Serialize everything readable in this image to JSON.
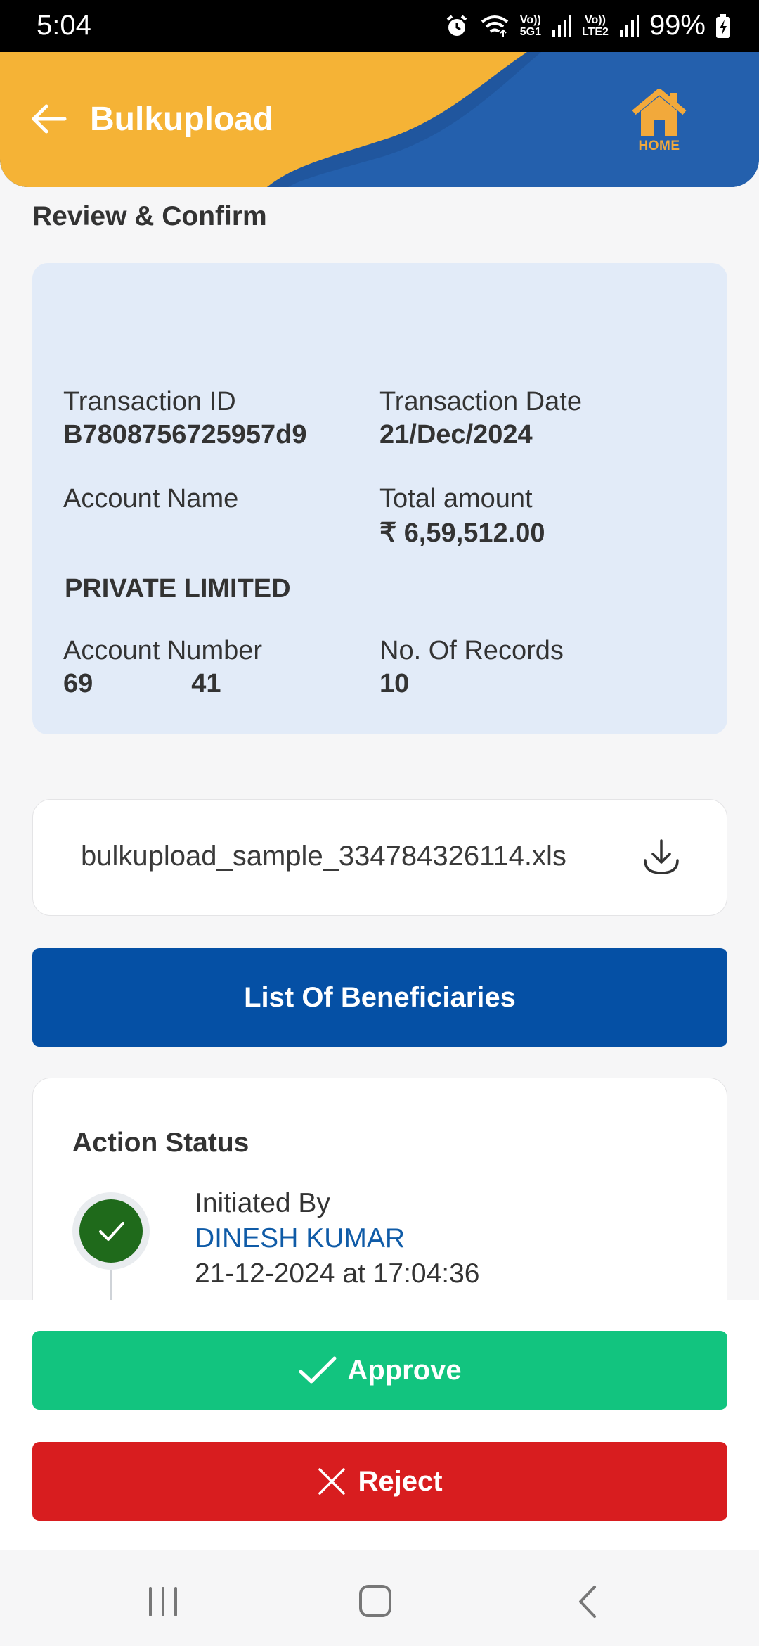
{
  "status_bar": {
    "time": "5:04",
    "sim1_top": "Vo))",
    "sim1_bottom": "5G1",
    "sim2_top": "Vo))",
    "sim2_bottom": "LTE2",
    "battery": "99%"
  },
  "header": {
    "title": "Bulkupload",
    "home_label": "HOME",
    "colors": {
      "blue": "#2460ad",
      "orange": "#f5b336"
    }
  },
  "review": {
    "title": "Review & Confirm",
    "transaction_id_label": "Transaction ID",
    "transaction_id": "B7808756725957d9",
    "transaction_date_label": "Transaction Date",
    "transaction_date": "21/Dec/2024",
    "account_name_label": "Account Name",
    "total_amount_label": "Total amount",
    "total_amount": "₹ 6,59,512.00",
    "company_name": "PRIVATE LIMITED",
    "account_number_label": "Account Number",
    "account_number_start": "69",
    "account_number_end": "41",
    "records_label": "No. Of Records",
    "records": "10"
  },
  "file": {
    "name": "bulkupload_sample_334784326114.xls"
  },
  "beneficiaries_button": "List Of Beneficiaries",
  "action_status": {
    "title": "Action Status",
    "initiated_label": "Initiated By",
    "initiated_name": "DINESH KUMAR",
    "initiated_time": "21-12-2024 at 17:04:36"
  },
  "actions": {
    "approve": "Approve",
    "reject": "Reject",
    "approve_color": "#12c47f",
    "reject_color": "#d81d1f"
  }
}
